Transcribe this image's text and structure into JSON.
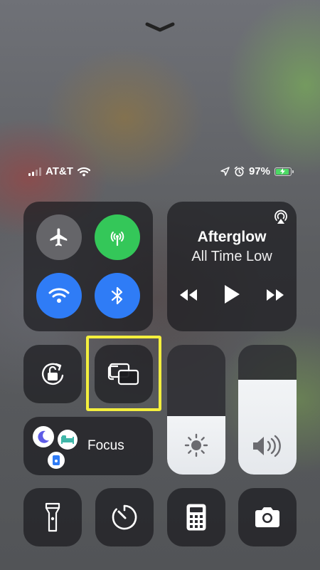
{
  "status_bar": {
    "carrier": "AT&T",
    "battery_percent": "97%",
    "signal_bars": 2,
    "battery_level": 0.97,
    "charging": true
  },
  "connectivity": {
    "airplane_mode": {
      "icon": "airplane-icon",
      "enabled": false
    },
    "cellular_data": {
      "icon": "antenna-icon",
      "enabled": true,
      "color": "#34c759"
    },
    "wifi": {
      "icon": "wifi-icon",
      "enabled": true,
      "color": "#2f7cf6"
    },
    "bluetooth": {
      "icon": "bluetooth-icon",
      "enabled": true,
      "color": "#2f7cf6"
    }
  },
  "now_playing": {
    "title": "Afterglow",
    "artist": "All Time Low",
    "playing": false
  },
  "controls": {
    "orientation_lock": {
      "icon": "rotation-lock-icon"
    },
    "screen_mirroring": {
      "icon": "screen-mirroring-icon",
      "highlighted": true,
      "highlight_color": "#f4ef3d"
    },
    "focus": {
      "label": "Focus"
    },
    "brightness_level": 0.45,
    "volume_level": 0.73
  },
  "bottom_row": [
    "flashlight-icon",
    "timer-icon",
    "calculator-icon",
    "camera-icon"
  ]
}
